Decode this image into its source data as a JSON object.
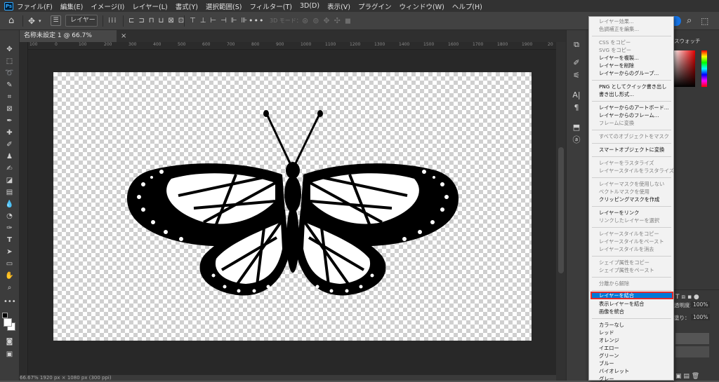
{
  "app": {
    "logo_text": "Ps",
    "accent": "#31a8ff",
    "highlight": "#0078d7",
    "highlight_border": "#e52c2c"
  },
  "menubar": {
    "items": [
      "ファイル(F)",
      "編集(E)",
      "イメージ(I)",
      "レイヤー(L)",
      "書式(Y)",
      "選択範囲(S)",
      "フィルター(T)",
      "3D(D)",
      "表示(V)",
      "プラグイン",
      "ウィンドウ(W)",
      "ヘルプ(H)"
    ]
  },
  "optionsbar": {
    "layer_select": "レイヤー ⌄",
    "mode_3d": "3D モード：",
    "more": "•••"
  },
  "document": {
    "tab_title": "名称未設定 1 @ 66.7% (RGB/8) *",
    "close": "×",
    "status": "66.67%      1920 px × 1080 px (300 ppi)"
  },
  "ruler": {
    "h": [
      "100",
      "0",
      "100",
      "200",
      "300",
      "400",
      "500",
      "600",
      "700",
      "800",
      "900",
      "1000",
      "1100",
      "1200",
      "1300",
      "1400",
      "1500",
      "1600",
      "1700",
      "1800",
      "1900",
      "20"
    ]
  },
  "panels": {
    "swatch_label": "スウォッチ",
    "opacity_label": "透明度：",
    "opacity_value": "100%",
    "fill_label": "塗り：",
    "fill_value": "100%"
  },
  "context_menu": {
    "items": [
      {
        "label": "レイヤー効果...",
        "enabled": false
      },
      {
        "label": "色調補正を編集...",
        "enabled": false
      },
      {
        "label": "CSS をコピー",
        "enabled": false
      },
      {
        "label": "SVG をコピー",
        "enabled": false
      },
      {
        "label": "レイヤーを複製...",
        "enabled": true
      },
      {
        "label": "レイヤーを削除",
        "enabled": true
      },
      {
        "label": "レイヤーからのグループ...",
        "enabled": true
      },
      {
        "label": "PNG としてクイック書き出し",
        "enabled": true
      },
      {
        "label": "書き出し形式...",
        "enabled": true
      },
      {
        "label": "レイヤーからのアートボード...",
        "enabled": true
      },
      {
        "label": "レイヤーからのフレーム...",
        "enabled": true
      },
      {
        "label": "フレームに変換",
        "enabled": false
      },
      {
        "label": "すべてのオブジェクトをマスク",
        "enabled": false
      },
      {
        "label": "スマートオブジェクトに変換",
        "enabled": true
      },
      {
        "label": "レイヤーをラスタライズ",
        "enabled": false
      },
      {
        "label": "レイヤースタイルをラスタライズ",
        "enabled": false
      },
      {
        "label": "レイヤーマスクを使用しない",
        "enabled": false
      },
      {
        "label": "ベクトルマスクを使用",
        "enabled": false
      },
      {
        "label": "クリッピングマスクを作成",
        "enabled": true
      },
      {
        "label": "レイヤーをリンク",
        "enabled": true
      },
      {
        "label": "リンクしたレイヤーを選択",
        "enabled": false
      },
      {
        "label": "レイヤースタイルをコピー",
        "enabled": false
      },
      {
        "label": "レイヤースタイルをペースト",
        "enabled": false
      },
      {
        "label": "レイヤースタイルを消去",
        "enabled": false
      },
      {
        "label": "シェイプ属性をコピー",
        "enabled": false
      },
      {
        "label": "シェイプ属性をペースト",
        "enabled": false
      },
      {
        "label": "分離から解除",
        "enabled": false
      },
      {
        "label": "レイヤーを結合",
        "enabled": true,
        "selected": true
      },
      {
        "label": "表示レイヤーを結合",
        "enabled": true
      },
      {
        "label": "画像を統合",
        "enabled": true
      },
      {
        "label": "カラーなし",
        "enabled": true
      },
      {
        "label": "レッド",
        "enabled": true
      },
      {
        "label": "オレンジ",
        "enabled": true
      },
      {
        "label": "イエロー",
        "enabled": true
      },
      {
        "label": "グリーン",
        "enabled": true
      },
      {
        "label": "ブルー",
        "enabled": true
      },
      {
        "label": "バイオレット",
        "enabled": true
      },
      {
        "label": "グレー",
        "enabled": true
      }
    ]
  },
  "icons": {
    "home": "⌂",
    "move": "✥",
    "search": "⌕",
    "share": "⬚"
  }
}
